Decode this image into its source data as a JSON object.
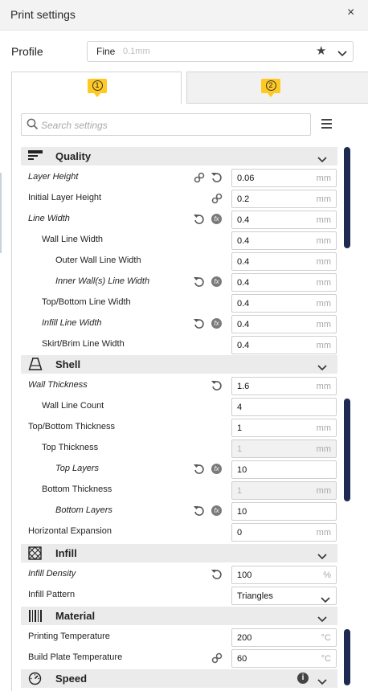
{
  "window": {
    "title": "Print settings",
    "close_glyph": "×"
  },
  "profile": {
    "label": "Profile",
    "name": "Fine",
    "quality": "0.1mm"
  },
  "tabs": [
    {
      "badge": "1"
    },
    {
      "badge": "2"
    }
  ],
  "search": {
    "placeholder": "Search settings"
  },
  "categories": {
    "quality": {
      "label": "Quality"
    },
    "shell": {
      "label": "Shell"
    },
    "infill": {
      "label": "Infill"
    },
    "material": {
      "label": "Material"
    },
    "speed": {
      "label": "Speed"
    }
  },
  "settings": {
    "layer_height": {
      "label": "Layer Height",
      "value": "0.06",
      "unit": "mm"
    },
    "initial_layer_height": {
      "label": "Initial Layer Height",
      "value": "0.2",
      "unit": "mm"
    },
    "line_width": {
      "label": "Line Width",
      "value": "0.4",
      "unit": "mm"
    },
    "wall_line_width": {
      "label": "Wall Line Width",
      "value": "0.4",
      "unit": "mm"
    },
    "outer_wall_line_width": {
      "label": "Outer Wall Line Width",
      "value": "0.4",
      "unit": "mm"
    },
    "inner_wall_line_width": {
      "label": "Inner Wall(s) Line Width",
      "value": "0.4",
      "unit": "mm"
    },
    "top_bottom_line_width": {
      "label": "Top/Bottom Line Width",
      "value": "0.4",
      "unit": "mm"
    },
    "infill_line_width": {
      "label": "Infill Line Width",
      "value": "0.4",
      "unit": "mm"
    },
    "skirt_brim_line_width": {
      "label": "Skirt/Brim Line Width",
      "value": "0.4",
      "unit": "mm"
    },
    "wall_thickness": {
      "label": "Wall Thickness",
      "value": "1.6",
      "unit": "mm"
    },
    "wall_line_count": {
      "label": "Wall Line Count",
      "value": "4",
      "unit": ""
    },
    "top_bottom_thickness": {
      "label": "Top/Bottom Thickness",
      "value": "1",
      "unit": "mm"
    },
    "top_thickness": {
      "label": "Top Thickness",
      "value": "1",
      "unit": "mm"
    },
    "top_layers": {
      "label": "Top Layers",
      "value": "10",
      "unit": ""
    },
    "bottom_thickness": {
      "label": "Bottom Thickness",
      "value": "1",
      "unit": "mm"
    },
    "bottom_layers": {
      "label": "Bottom Layers",
      "value": "10",
      "unit": ""
    },
    "horizontal_expansion": {
      "label": "Horizontal Expansion",
      "value": "0",
      "unit": "mm"
    },
    "infill_density": {
      "label": "Infill Density",
      "value": "100",
      "unit": "%"
    },
    "infill_pattern": {
      "label": "Infill Pattern",
      "value": "Triangles"
    },
    "printing_temperature": {
      "label": "Printing Temperature",
      "value": "200",
      "unit": "°C"
    },
    "build_plate_temperature": {
      "label": "Build Plate Temperature",
      "value": "60",
      "unit": "°C"
    }
  },
  "icons": {
    "link": "link-icon",
    "reset": "reset-icon",
    "function": "function-icon",
    "fx_glyph": "fx",
    "info_glyph": "i"
  },
  "colors": {
    "accent_badge": "#ffc924",
    "scrollbar": "#1f2a52",
    "category_bg": "#ebebeb"
  }
}
